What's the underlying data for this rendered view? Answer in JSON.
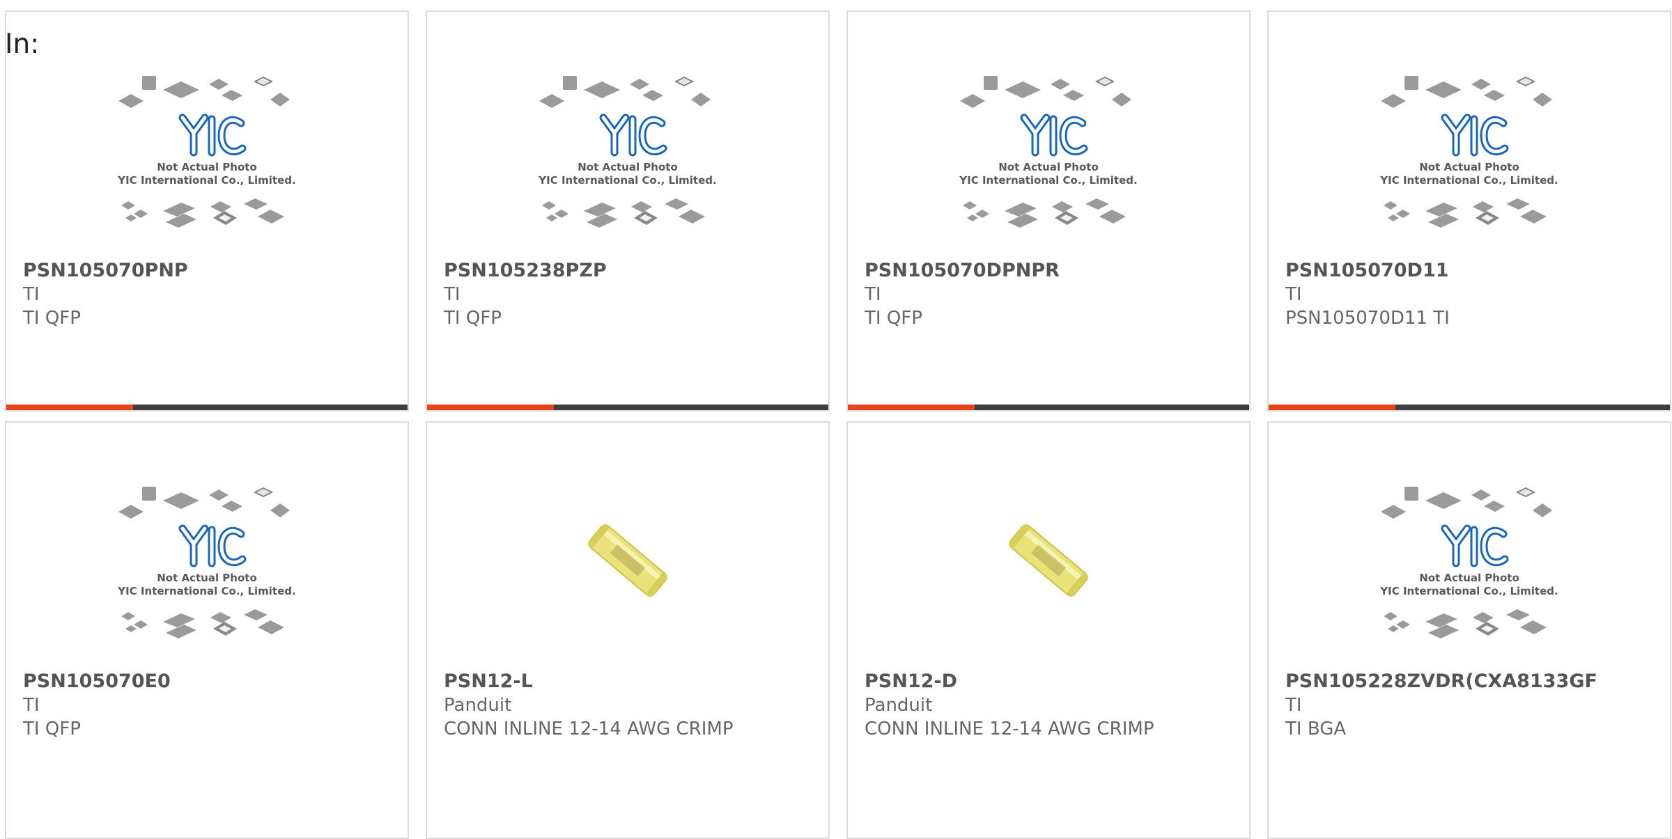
{
  "header": {
    "in_label": "In:"
  },
  "colors": {
    "accent": "#e8431a",
    "bar": "#3e3e3e",
    "logo_blue": "#1a66b8",
    "border": "#dcdcdc"
  },
  "placeholder": {
    "line1": "Not Actual Photo",
    "line2": "YIC International Co., Limited.",
    "logo_text": "YIC"
  },
  "products": [
    {
      "part_number": "PSN105070PNP",
      "manufacturer": "TI",
      "description": "TI QFP",
      "image": "placeholder-icon",
      "has_bar": true
    },
    {
      "part_number": "PSN105238PZP",
      "manufacturer": "TI",
      "description": "TI QFP",
      "image": "placeholder-icon",
      "has_bar": true
    },
    {
      "part_number": "PSN105070DPNPR",
      "manufacturer": "TI",
      "description": "TI QFP",
      "image": "placeholder-icon",
      "has_bar": true
    },
    {
      "part_number": "PSN105070D11",
      "manufacturer": "TI",
      "description": "PSN105070D11 TI",
      "image": "placeholder-icon",
      "has_bar": true
    },
    {
      "part_number": "PSN105070E0",
      "manufacturer": "TI",
      "description": "TI QFP",
      "image": "placeholder-icon",
      "has_bar": false
    },
    {
      "part_number": "PSN12-L",
      "manufacturer": "Panduit",
      "description": "CONN INLINE 12-14 AWG CRIMP",
      "image": "crimp-connector-icon",
      "has_bar": false
    },
    {
      "part_number": "PSN12-D",
      "manufacturer": "Panduit",
      "description": "CONN INLINE 12-14 AWG CRIMP",
      "image": "crimp-connector-icon",
      "has_bar": false
    },
    {
      "part_number": "PSN105228ZVDR(CXA8133GF",
      "manufacturer": "TI",
      "description": "TI BGA",
      "image": "placeholder-icon",
      "has_bar": false
    }
  ]
}
